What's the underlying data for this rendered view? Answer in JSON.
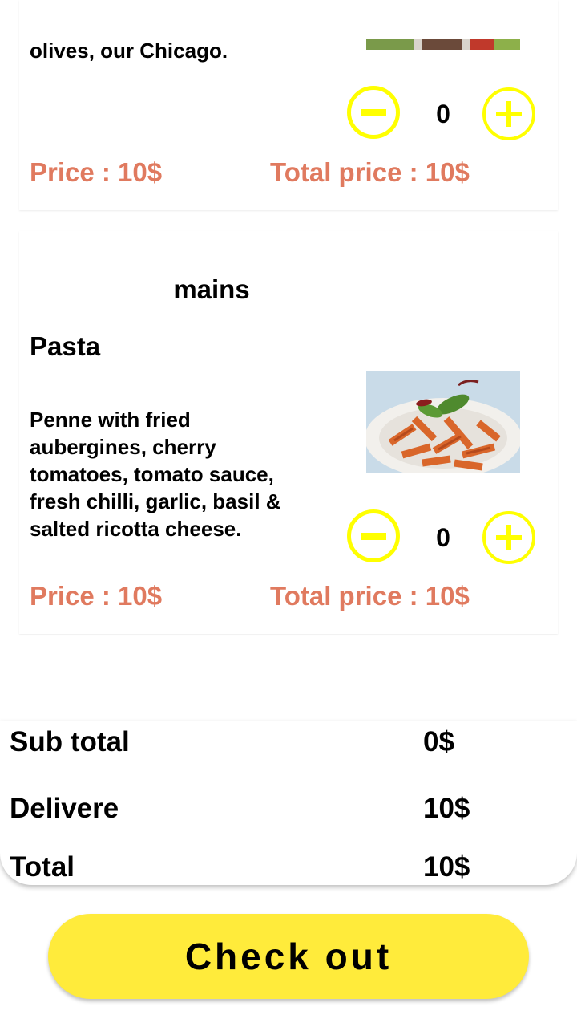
{
  "items": [
    {
      "description_tail": "olives, our Chicago.",
      "quantity": "0",
      "price_label": "Price : 10$",
      "total_price_label": "Total price : 10$"
    },
    {
      "category": "mains",
      "name": "Pasta",
      "description": "Penne with fried aubergines, cherry tomatoes, tomato sauce, fresh chilli, garlic, basil & salted ricotta cheese.",
      "quantity": "0",
      "price_label": "Price : 10$",
      "total_price_label": "Total price : 10$"
    }
  ],
  "summary": {
    "subtotal_label": "Sub total",
    "subtotal_value": "0$",
    "delivery_label": "Delivere",
    "delivery_value": "10$",
    "total_label": "Total",
    "total_value": "10$"
  },
  "checkout_label": "Check out",
  "colors": {
    "accent_yellow": "#ffff00",
    "button_yellow": "#ffeb3b",
    "price_color": "#e07a5f"
  },
  "icons": [
    "minus-circle-icon",
    "plus-circle-icon"
  ]
}
